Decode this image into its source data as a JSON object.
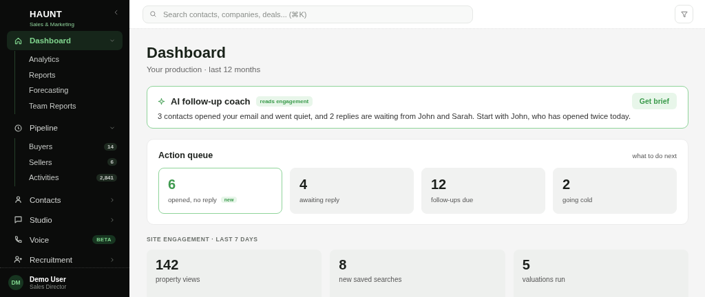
{
  "brand": {
    "name": "HAUNT",
    "subtitle": "Sales & Marketing"
  },
  "nav": [
    {
      "label": "Dashboard",
      "kind": "home",
      "selected": true,
      "expanded": true,
      "children": [
        {
          "label": "Analytics"
        },
        {
          "label": "Reports"
        },
        {
          "label": "Forecasting"
        },
        {
          "label": "Team Reports"
        }
      ]
    },
    {
      "label": "Pipeline",
      "kind": "clock",
      "selected": false,
      "expanded": true,
      "children": [
        {
          "label": "Buyers",
          "badge": "14"
        },
        {
          "label": "Sellers",
          "badge": "6"
        },
        {
          "label": "Activities",
          "badge": "2,841"
        }
      ]
    },
    {
      "label": "Contacts",
      "kind": "person",
      "selected": false,
      "expanded": false
    },
    {
      "label": "Studio",
      "kind": "chat",
      "selected": false,
      "expanded": false
    },
    {
      "label": "Voice",
      "kind": "phone",
      "selected": false,
      "badge": "BETA"
    },
    {
      "label": "Recruitment",
      "kind": "person-plus",
      "selected": false,
      "expanded": false
    }
  ],
  "user": {
    "initials": "DM",
    "name": "Demo User",
    "role": "Sales Director"
  },
  "search": {
    "placeholder": "Search contacts, companies, deals... (⌘K)"
  },
  "page": {
    "title": "Dashboard",
    "subtitle": "Your production · last 12 months"
  },
  "coach": {
    "title": "AI follow-up coach",
    "tag": "reads engagement",
    "button": "Get brief",
    "message": "3 contacts opened your email and went quiet, and 2 replies are waiting from John and Sarah. Start with John, who has opened twice today."
  },
  "queue": {
    "title": "Action queue",
    "link": "what to do next",
    "items": [
      {
        "value": "6",
        "label": "opened, no reply",
        "tag": "new",
        "selected": true
      },
      {
        "value": "4",
        "label": "awaiting reply",
        "selected": false
      },
      {
        "value": "12",
        "label": "follow-ups due",
        "selected": false
      },
      {
        "value": "2",
        "label": "going cold",
        "selected": false
      }
    ]
  },
  "engagement": {
    "heading": "SITE ENGAGEMENT · LAST 7 DAYS",
    "items": [
      {
        "value": "142",
        "label": "property views"
      },
      {
        "value": "8",
        "label": "new saved searches"
      },
      {
        "value": "5",
        "label": "valuations run"
      }
    ]
  }
}
